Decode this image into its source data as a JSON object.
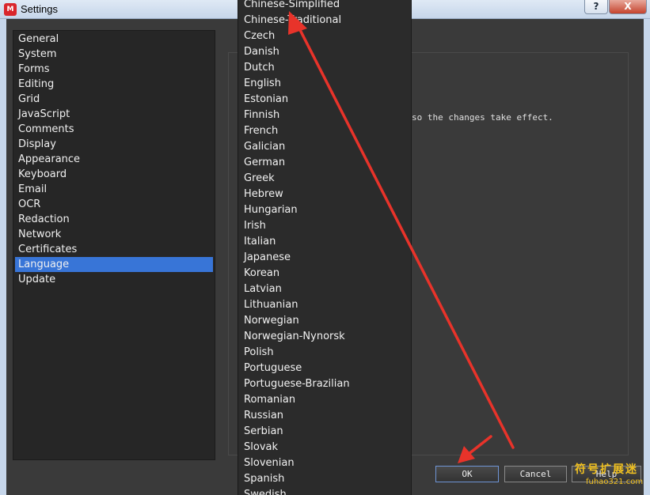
{
  "window": {
    "title": "Settings",
    "help_glyph": "?",
    "close_glyph": "X",
    "app_icon_glyph": "M"
  },
  "sidebar": {
    "items": [
      {
        "label": "General"
      },
      {
        "label": "System"
      },
      {
        "label": "Forms"
      },
      {
        "label": "Editing"
      },
      {
        "label": "Grid"
      },
      {
        "label": "JavaScript"
      },
      {
        "label": "Comments"
      },
      {
        "label": "Display"
      },
      {
        "label": "Appearance"
      },
      {
        "label": "Keyboard"
      },
      {
        "label": "Email"
      },
      {
        "label": "OCR"
      },
      {
        "label": "Redaction"
      },
      {
        "label": "Network"
      },
      {
        "label": "Certificates"
      },
      {
        "label": "Language"
      },
      {
        "label": "Update"
      }
    ],
    "selected": "Language"
  },
  "content": {
    "note_fragment": "so the changes take effect."
  },
  "language_dropdown": {
    "options": [
      "Chinese-Simplified",
      "Chinese-Traditional",
      "Czech",
      "Danish",
      "Dutch",
      "English",
      "Estonian",
      "Finnish",
      "French",
      "Galician",
      "German",
      "Greek",
      "Hebrew",
      "Hungarian",
      "Irish",
      "Italian",
      "Japanese",
      "Korean",
      "Latvian",
      "Lithuanian",
      "Norwegian",
      "Norwegian-Nynorsk",
      "Polish",
      "Portuguese",
      "Portuguese-Brazilian",
      "Romanian",
      "Russian",
      "Serbian",
      "Slovak",
      "Slovenian",
      "Spanish",
      "Swedish"
    ]
  },
  "buttons": {
    "ok": "OK",
    "cancel": "Cancel",
    "help": "Help"
  },
  "watermark": {
    "cn": "符号扩展迷",
    "en": "fuhao321.com"
  },
  "colors": {
    "selection": "#3875d7",
    "annotation_arrow": "#e8332a",
    "watermark": "#f0c020"
  }
}
